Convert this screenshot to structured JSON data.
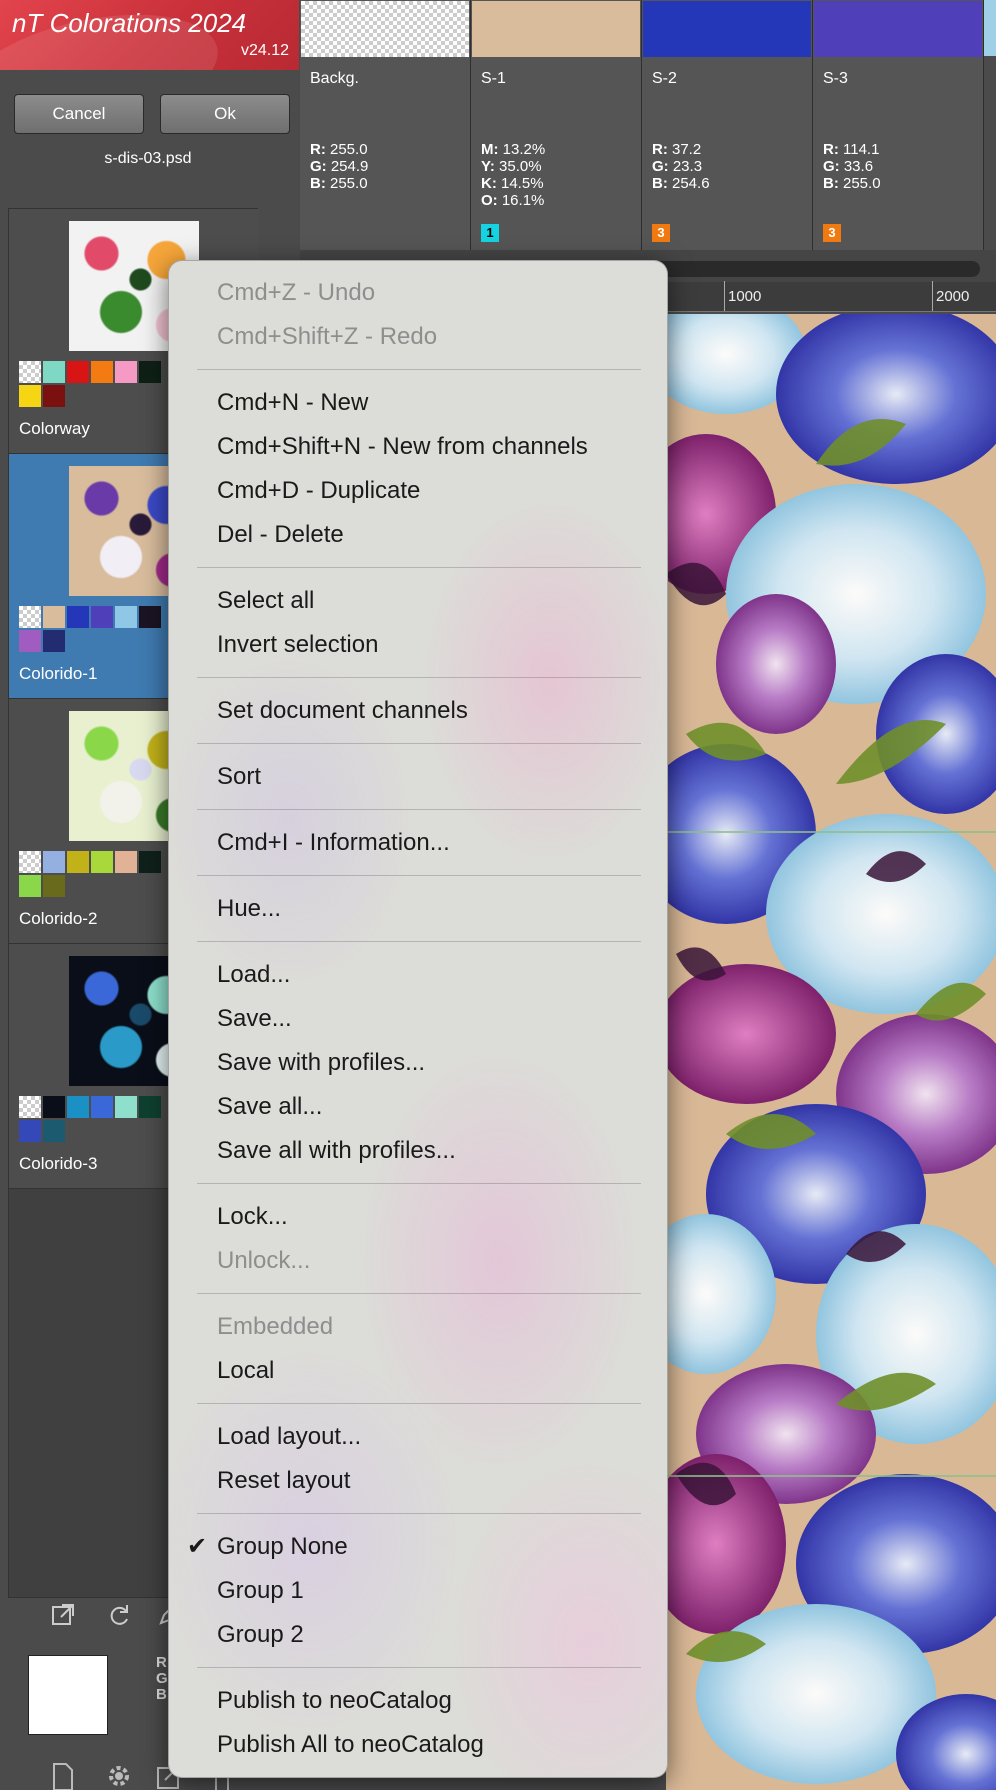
{
  "app": {
    "title": "nT Colorations 2024",
    "version": "v24.12"
  },
  "buttons": {
    "cancel": "Cancel",
    "ok": "Ok"
  },
  "document": {
    "filename": "s-dis-03.psd"
  },
  "channels": [
    {
      "name": "Backg.",
      "color": "checker",
      "values": [
        [
          "R:",
          "255.0"
        ],
        [
          "G:",
          "254.9"
        ],
        [
          "B:",
          "255.0"
        ]
      ],
      "badge": ""
    },
    {
      "name": "S-1",
      "color": "#d8bc9c",
      "values": [
        [
          "M:",
          "13.2%"
        ],
        [
          "Y:",
          "35.0%"
        ],
        [
          "K:",
          "14.5%"
        ],
        [
          "O:",
          "16.1%"
        ]
      ],
      "badge": "1",
      "badge_color": "#15d3e0"
    },
    {
      "name": "S-2",
      "color": "#2437b8",
      "values": [
        [
          "R:",
          "37.2"
        ],
        [
          "G:",
          "23.3"
        ],
        [
          "B:",
          "254.6"
        ]
      ],
      "badge": "3",
      "badge_color": "#f07a10"
    },
    {
      "name": "S-3",
      "color": "#4f3fb8",
      "values": [
        [
          "R:",
          "114.1"
        ],
        [
          "G:",
          "33.6"
        ],
        [
          "B:",
          "255.0"
        ]
      ],
      "badge": "3",
      "badge_color": "#f07a10"
    }
  ],
  "ruler": {
    "labels": [
      "1000",
      "2000"
    ]
  },
  "colorways": [
    {
      "name": "Colorway",
      "swatches": [
        "checker",
        "#7fd8c4",
        "#d81414",
        "#f47b12",
        "#f59ac4",
        "#0e2016",
        "#f5d514",
        "#7a1010"
      ],
      "selected": false
    },
    {
      "name": "Colorido-1",
      "swatches": [
        "checker",
        "#d8bc9c",
        "#2437b8",
        "#4f3fb8",
        "#8ec8e6",
        "#1a1424",
        "#a05cc0",
        "#232c70"
      ],
      "selected": true
    },
    {
      "name": "Colorido-2",
      "swatches": [
        "checker",
        "#94b0e0",
        "#c2b21a",
        "#a8d83a",
        "#e2b296",
        "#10201a",
        "#8ad84a",
        "#6a6a1c"
      ],
      "selected": false
    },
    {
      "name": "Colorido-3",
      "swatches": [
        "checker",
        "#0a0e18",
        "#1a90c4",
        "#3a68d8",
        "#8ee0cc",
        "#0e4030",
        "#3448b8",
        "#1c5a70"
      ],
      "selected": false
    }
  ],
  "bottom": {
    "rgb_labels": [
      "R",
      "G",
      "B"
    ]
  },
  "icons": {
    "tools": [
      "external-link-icon",
      "refresh-icon",
      "pen-icon"
    ],
    "footer": [
      "new-document-icon",
      "gear-icon",
      "import-icon",
      "tool-icon"
    ]
  },
  "menu": {
    "items": [
      {
        "label": "Cmd+Z - Undo",
        "enabled": false
      },
      {
        "label": "Cmd+Shift+Z - Redo",
        "enabled": false
      },
      {
        "sep": true
      },
      {
        "label": "Cmd+N - New",
        "enabled": true
      },
      {
        "label": "Cmd+Shift+N - New from channels",
        "enabled": true
      },
      {
        "label": "Cmd+D - Duplicate",
        "enabled": true
      },
      {
        "label": "Del - Delete",
        "enabled": true
      },
      {
        "sep": true
      },
      {
        "label": "Select all",
        "enabled": true
      },
      {
        "label": "Invert selection",
        "enabled": true
      },
      {
        "sep": true
      },
      {
        "label": "Set document channels",
        "enabled": true
      },
      {
        "sep": true
      },
      {
        "label": "Sort",
        "enabled": true
      },
      {
        "sep": true
      },
      {
        "label": "Cmd+I - Information...",
        "enabled": true
      },
      {
        "sep": true
      },
      {
        "label": "Hue...",
        "enabled": true
      },
      {
        "sep": true
      },
      {
        "label": "Load...",
        "enabled": true
      },
      {
        "label": "Save...",
        "enabled": true
      },
      {
        "label": "Save with profiles...",
        "enabled": true
      },
      {
        "label": "Save all...",
        "enabled": true
      },
      {
        "label": "Save all with profiles...",
        "enabled": true
      },
      {
        "sep": true
      },
      {
        "label": "Lock...",
        "enabled": true
      },
      {
        "label": "Unlock...",
        "enabled": false
      },
      {
        "sep": true
      },
      {
        "label": "Embedded",
        "enabled": false
      },
      {
        "label": "Local",
        "enabled": true
      },
      {
        "sep": true
      },
      {
        "label": "Load layout...",
        "enabled": true
      },
      {
        "label": "Reset layout",
        "enabled": true
      },
      {
        "sep": true
      },
      {
        "label": "Group None",
        "enabled": true,
        "checked": true
      },
      {
        "label": "Group 1",
        "enabled": true
      },
      {
        "label": "Group 2",
        "enabled": true
      },
      {
        "sep": true
      },
      {
        "label": "Publish to neoCatalog",
        "enabled": true
      },
      {
        "label": "Publish All to neoCatalog",
        "enabled": true
      }
    ]
  }
}
